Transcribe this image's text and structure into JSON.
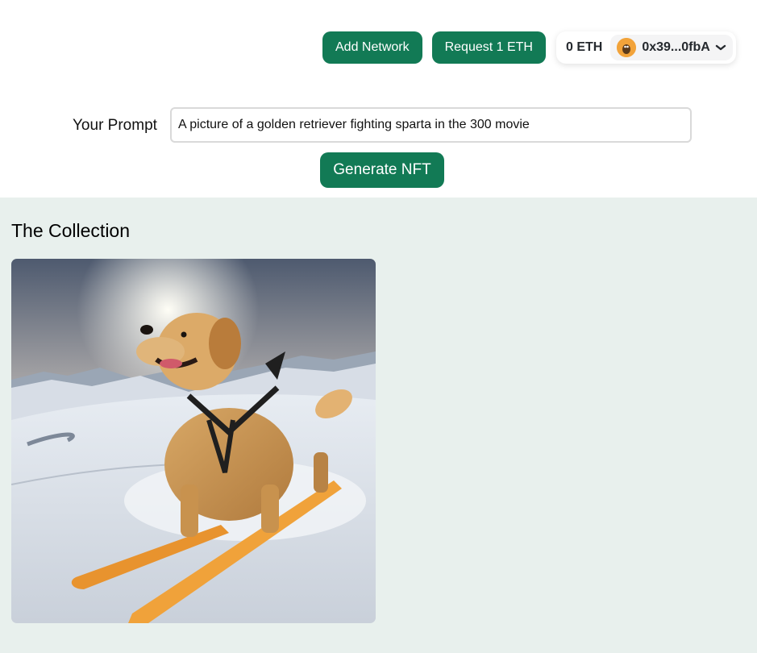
{
  "header": {
    "add_network_label": "Add Network",
    "request_eth_label": "Request 1 ETH",
    "wallet": {
      "balance": "0 ETH",
      "address": "0x39...0fbA",
      "chevron": "❯"
    }
  },
  "prompt": {
    "label": "Your Prompt",
    "value": "A picture of a golden retriever fighting sparta in the 300 movie",
    "generate_label": "Generate NFT"
  },
  "collection": {
    "title": "The Collection",
    "items": [
      {
        "image": "golden-retriever-skiing"
      }
    ]
  },
  "colors": {
    "accent": "#127a55",
    "collection_bg": "#e8f0ed"
  }
}
